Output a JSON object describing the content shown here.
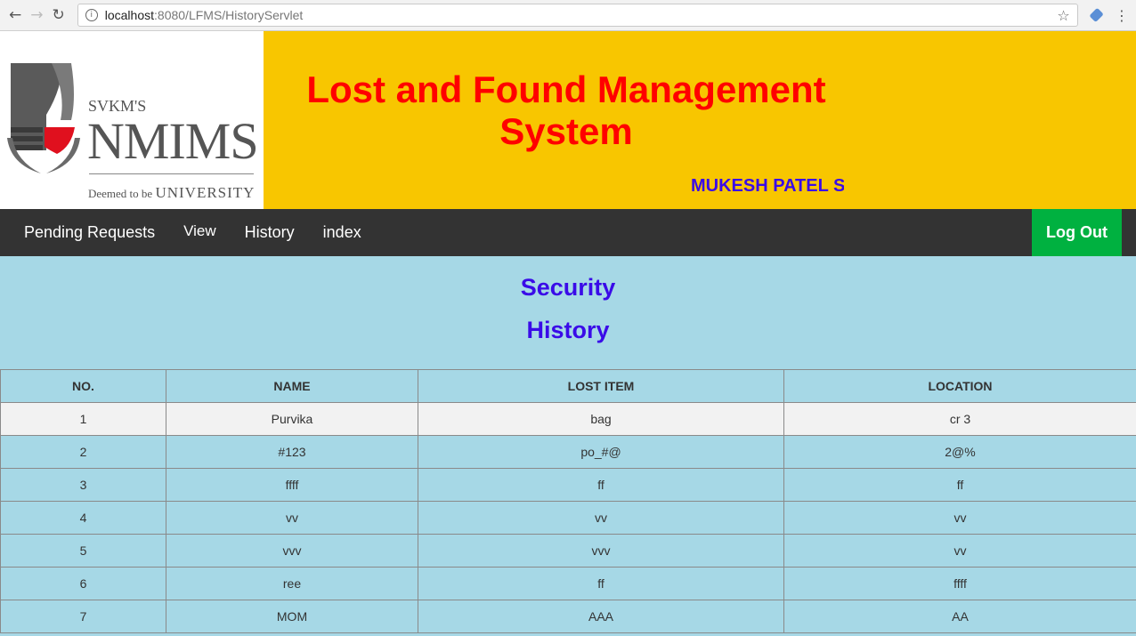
{
  "browser": {
    "url_host": "localhost",
    "url_rest": ":8080/LFMS/HistoryServlet"
  },
  "header": {
    "logo_svkm": "SVKM'S",
    "logo_nmims": "NMIMS",
    "logo_deemed": "Deemed to be",
    "logo_university": "UNIVERSITY",
    "title": "Lost and Found Management System",
    "marquee": "MUKESH PATEL S"
  },
  "nav": {
    "items": [
      {
        "label": "Pending Requests"
      },
      {
        "label": "View"
      },
      {
        "label": "History"
      },
      {
        "label": "index"
      }
    ],
    "logout": "Log Out"
  },
  "main": {
    "heading1": "Security",
    "heading2": "History",
    "table": {
      "columns": [
        "NO.",
        "NAME",
        "LOST ITEM",
        "LOCATION"
      ],
      "rows": [
        [
          "1",
          "Purvika",
          "bag",
          "cr 3"
        ],
        [
          "2",
          "#123",
          "po_#@",
          "2@%"
        ],
        [
          "3",
          "ffff",
          "ff",
          "ff"
        ],
        [
          "4",
          "vv",
          "vv",
          "vv"
        ],
        [
          "5",
          "vvv",
          "vvv",
          "vv"
        ],
        [
          "6",
          "ree",
          "ff",
          "ffff"
        ],
        [
          "7",
          "MOM",
          "AAA",
          "AA"
        ]
      ]
    }
  },
  "colors": {
    "banner_yellow": "#f8c600",
    "title_red": "#ff0000",
    "heading_blue": "#3a0be8",
    "navbar": "#333333",
    "logout_green": "#00b140",
    "page_bg": "#a6d8e6"
  }
}
